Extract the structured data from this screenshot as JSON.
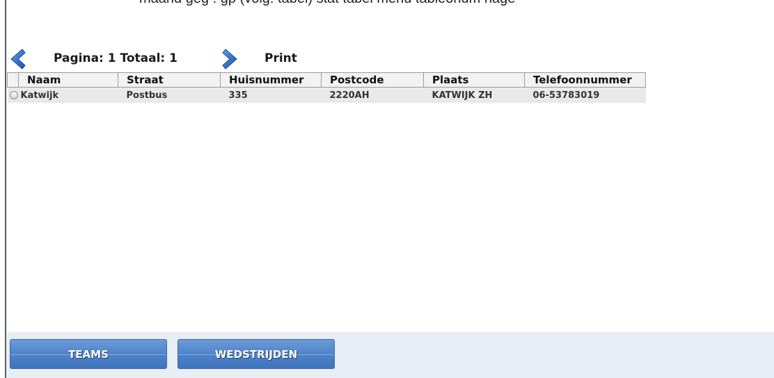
{
  "header": {
    "clipped_text": "maand geg . gp (volg. tabel) stat   tabel  menu  tableonum  nage"
  },
  "pager": {
    "prev_icon": "chevron-left-icon",
    "label": "Pagina: 1 Totaal: 1",
    "next_icon": "chevron-right-icon",
    "print_label": "Print"
  },
  "table": {
    "columns": [
      "Naam",
      "Straat",
      "Huisnummer",
      "Postcode",
      "Plaats",
      "Telefoonnummer"
    ],
    "rows": [
      {
        "naam": "Katwijk",
        "straat": "Postbus",
        "huisnummer": "335",
        "postcode": "2220AH",
        "plaats": "KATWIJK ZH",
        "telefoonnummer": "06-53783019",
        "selected": false
      }
    ]
  },
  "footer": {
    "teams_label": "TEAMS",
    "wedstrijden_label": "WEDSTRIJDEN"
  },
  "colors": {
    "accent": "#1f5fbf",
    "button": "#4f83c9",
    "footer_bg": "#e7eef6",
    "row_bg": "#e9e9e9"
  }
}
